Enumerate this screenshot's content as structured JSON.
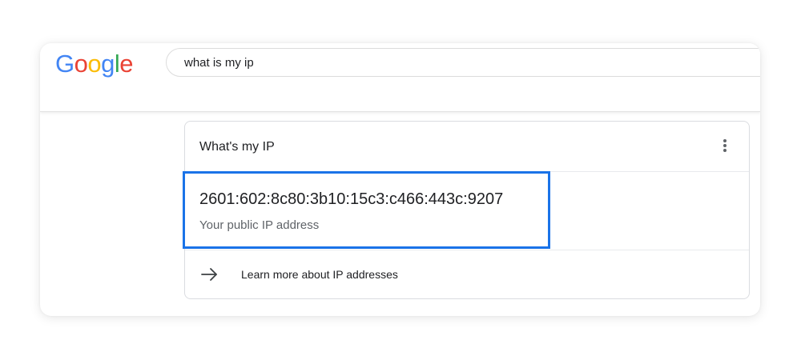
{
  "logo": {
    "letters": [
      "G",
      "o",
      "o",
      "g",
      "l",
      "e"
    ],
    "colors": [
      "#4285F4",
      "#EA4335",
      "#FBBC05",
      "#4285F4",
      "#34A853",
      "#EA4335"
    ]
  },
  "search": {
    "query": "what is my ip"
  },
  "card": {
    "title": "What's my IP",
    "menu_icon": "more-vert-icon",
    "ip_address": "2601:602:8c80:3b10:15c3:c466:443c:9207",
    "ip_caption": "Your public IP address",
    "highlight_color": "#1a73e8",
    "learn_more": {
      "icon": "arrow-right-icon",
      "label": "Learn more about IP addresses"
    }
  }
}
